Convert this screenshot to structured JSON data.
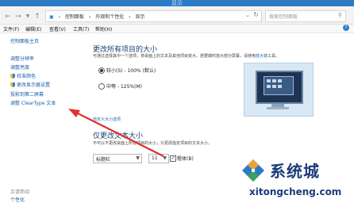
{
  "window": {
    "title": "显示"
  },
  "address_bar": {
    "crumbs": [
      "控制面板",
      "外观和个性化",
      "显示"
    ],
    "search_placeholder": "搜索控制面板"
  },
  "menu": [
    "文件(F)",
    "编辑(E)",
    "查看(V)",
    "工具(T)",
    "帮助(H)"
  ],
  "sidebar": {
    "home": "控制面板主页",
    "items": [
      "调整分辨率",
      "调整亮度",
      "校准颜色",
      "更改显示器设置",
      "投影到第二屏幕",
      "调整 ClearType 文本"
    ],
    "see_also": "另请参阅",
    "personalization": "个性化"
  },
  "main": {
    "size_heading": "更改所有项目的大小",
    "size_desc": "可通过选择其中一个选项，将桌面上的文本及其他项目变大。若要做时放大部分屏幕，请使用",
    "size_desc_link": "放大镜",
    "size_desc_end": "工具。",
    "option_small": "较小(S) - 100% (默认)",
    "option_medium": "中等 - 125%(M)",
    "selected_option": "small",
    "custom_link": "自定义大小选项",
    "text_heading": "仅更改文本大小",
    "text_desc": "不可以不更改桌面上所有项目的大小，只更改指定项目的文本大小。",
    "item_select": "标题栏",
    "size_select": "11",
    "bold_label": "粗体(B)",
    "bold_checked": true
  },
  "watermark": {
    "cn": "系统城",
    "en": "xitongcheng.com"
  },
  "colors": {
    "accent": "#2b7bc4",
    "link": "#1a5fa8",
    "arrow": "#e03030"
  }
}
